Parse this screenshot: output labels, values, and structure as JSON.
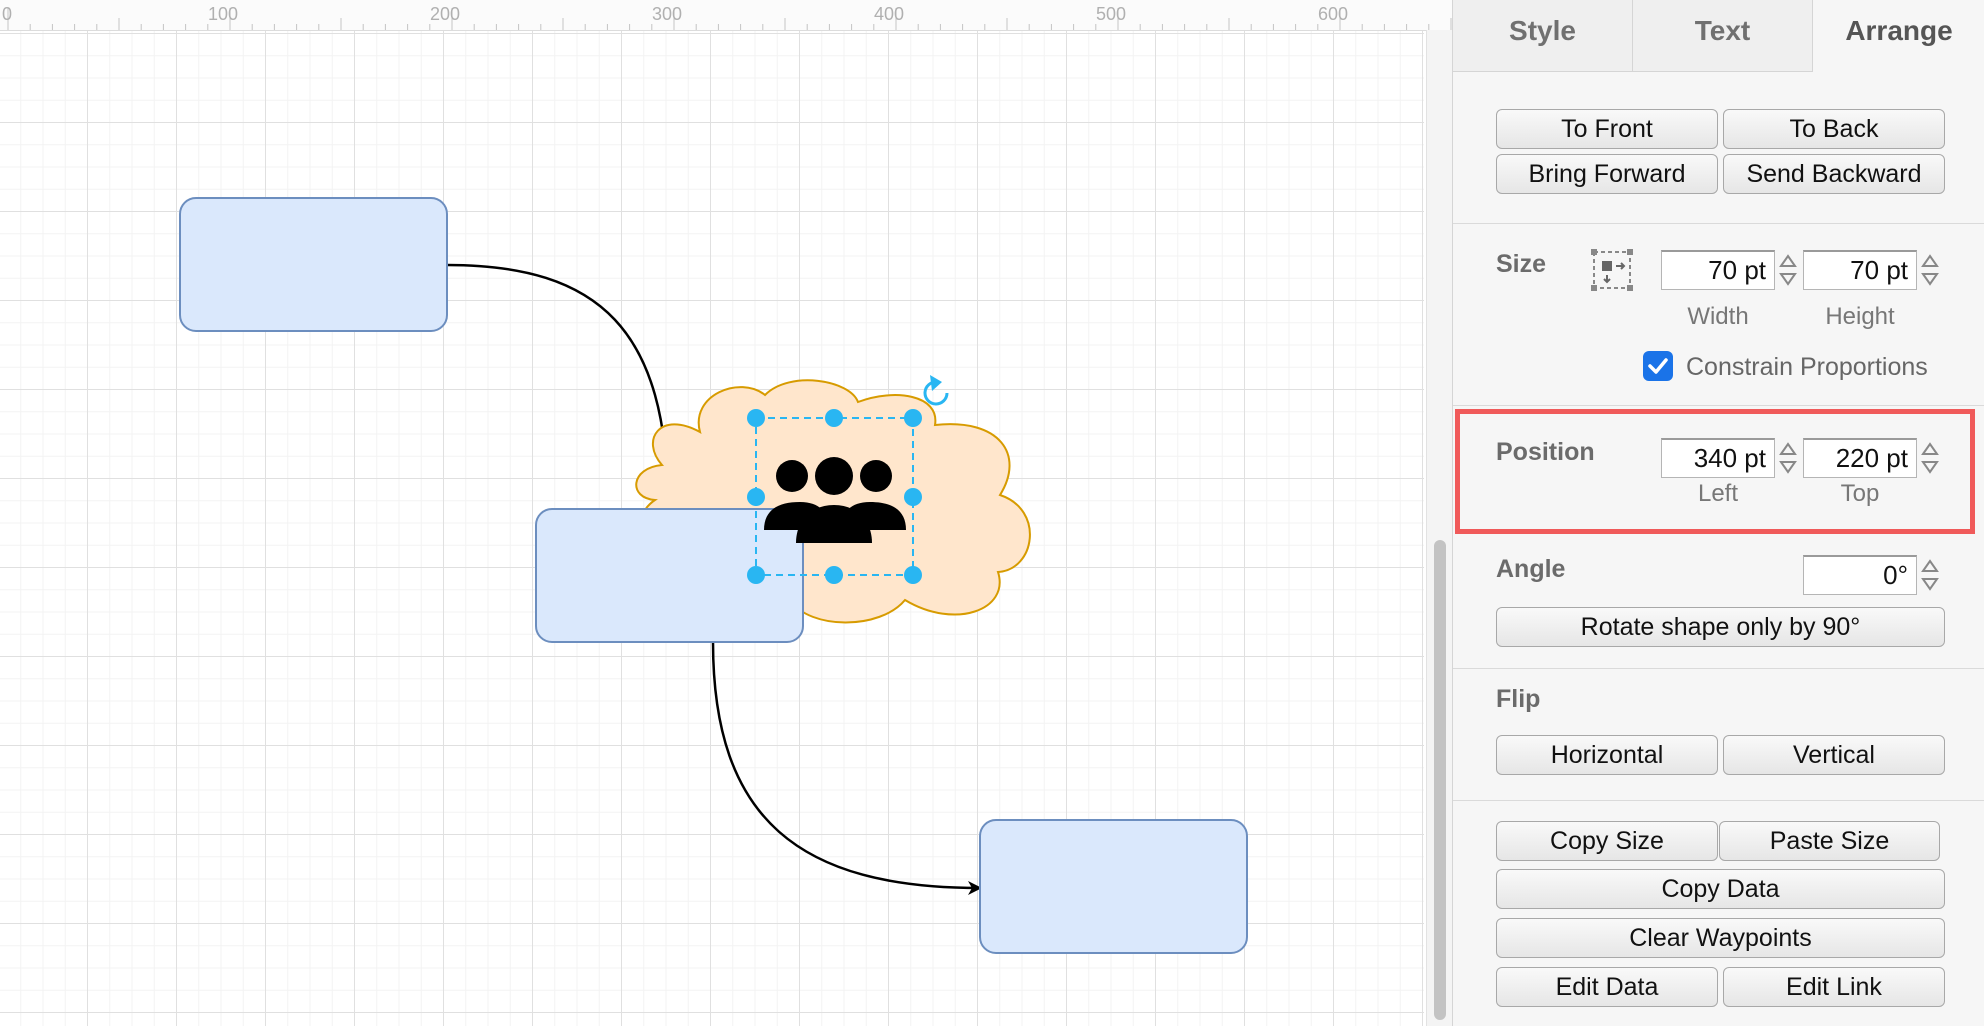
{
  "ruler": {
    "labels": [
      "0",
      "100",
      "200",
      "300",
      "400",
      "500",
      "600"
    ]
  },
  "tabs": [
    {
      "label": "Style",
      "active": false
    },
    {
      "label": "Text",
      "active": false
    },
    {
      "label": "Arrange",
      "active": true
    }
  ],
  "order": {
    "to_front": "To Front",
    "to_back": "To Back",
    "bring_forward": "Bring Forward",
    "send_backward": "Send Backward"
  },
  "size": {
    "label": "Size",
    "width": "70 pt",
    "height": "70 pt",
    "width_label": "Width",
    "height_label": "Height",
    "constrain": "Constrain Proportions",
    "constrain_checked": true,
    "icon": "resize-icon"
  },
  "position": {
    "label": "Position",
    "left": "340 pt",
    "top": "220 pt",
    "left_label": "Left",
    "top_label": "Top",
    "highlight_color": "#f05a5a"
  },
  "angle": {
    "label": "Angle",
    "value": "0°",
    "rotate_button": "Rotate shape only by 90°"
  },
  "flip": {
    "label": "Flip",
    "horizontal": "Horizontal",
    "vertical": "Vertical"
  },
  "actions": {
    "copy_size": "Copy Size",
    "paste_size": "Paste Size",
    "copy_data": "Copy Data",
    "clear_waypoints": "Clear Waypoints",
    "edit_data": "Edit Data",
    "edit_link": "Edit Link"
  },
  "diagram": {
    "box_fill": "#dae8fc",
    "box_stroke": "#6c8ebf",
    "cloud_fill": "#ffe6cc",
    "cloud_stroke": "#d79b00",
    "selection_color": "#29b6f2",
    "icons": [
      "users-icon",
      "rotate-handle-icon"
    ]
  }
}
